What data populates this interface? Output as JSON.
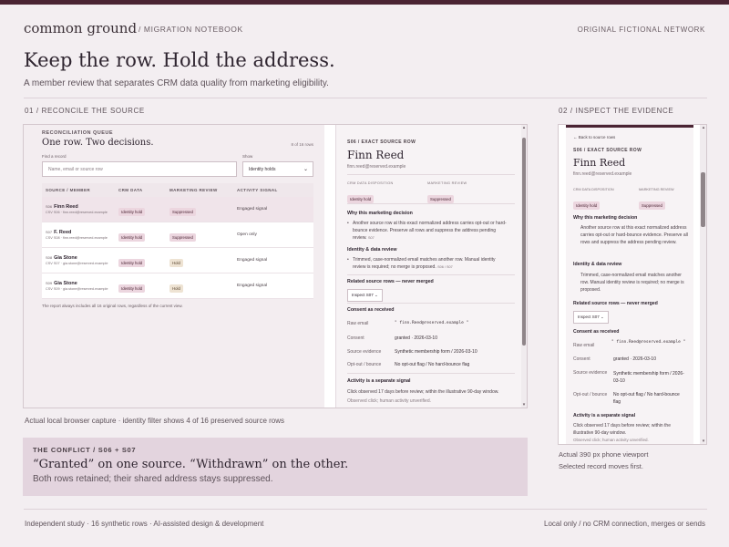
{
  "brand": "common ground",
  "breadcrumb": "/ MIGRATION NOTEBOOK",
  "network": "ORIGINAL FICTIONAL NETWORK",
  "headline": "Keep the row. Hold the address.",
  "subtitle": "A member review that separates CRM data quality from marketing eligibility.",
  "sections": {
    "left": "01 / RECONCILE THE SOURCE",
    "right": "02 / INSPECT THE EVIDENCE"
  },
  "queue": {
    "label": "RECONCILIATION QUEUE",
    "title": "One row. Two decisions.",
    "count": "8 of 16 rows",
    "find_label": "Find a record",
    "find_placeholder": "Name, email or source row",
    "show_label": "Show",
    "show_value": "Identity holds",
    "columns": [
      "SOURCE / MEMBER",
      "CRM DATA",
      "MARKETING REVIEW",
      "ACTIVITY SIGNAL"
    ],
    "rows": [
      {
        "idx": "S06",
        "name": "Finn Reed",
        "sub": "CSV S06 · finn.reed@reserved.example",
        "crm": "Identity hold",
        "review": "Suppressed",
        "signal": "Engaged signal"
      },
      {
        "idx": "S07",
        "name": "F. Reed",
        "sub": "CSV S08 · finn.reed@reserved.example",
        "crm": "Identity hold",
        "review": "Suppressed",
        "signal": "Open only"
      },
      {
        "idx": "S08",
        "name": "Gia Stone",
        "sub": "CSV S07 · gia.stone@reserved.example",
        "crm": "Identity hold",
        "review": "Hold",
        "signal": "Engaged signal"
      },
      {
        "idx": "S09",
        "name": "Gia Stone",
        "sub": "CSV S09 · gia.stone@reserved.example",
        "crm": "Identity hold",
        "review": "Hold",
        "signal": "Engaged signal"
      }
    ],
    "note": "The report always includes all 16 original rows, regardless of the current view."
  },
  "detail": {
    "label": "S06 / EXACT SOURCE ROW",
    "name": "Finn Reed",
    "email": "finn.reed@reserved.example",
    "disp_label": "CRM DATA DISPOSITION",
    "disp_value": "Identity hold",
    "review_label": "MARKETING REVIEW",
    "review_value": "Suppressed",
    "why_heading": "Why this marketing decision",
    "why_text": "Another source row at this exact normalized address carries opt-out or hard-bounce evidence. Preserve all rows and suppress the address pending review.",
    "why_tag": "S07",
    "identity_heading": "Identity & data review",
    "identity_text": "Trimmed, case-normalized email matches another row. Manual identity review is required; no merge is proposed.",
    "identity_tag": "S06 / S07",
    "related_heading": "Related source rows — never merged",
    "inspect_button": "Inspect S07",
    "consent_heading": "Consent as received",
    "consent": [
      {
        "k": "Raw email",
        "v": "\" finn.Reed@reserved.example \""
      },
      {
        "k": "Consent",
        "v": "granted · 2026-03-10"
      },
      {
        "k": "Source evidence",
        "v": "Synthetic membership form / 2026-03-10"
      },
      {
        "k": "Opt-out / bounce",
        "v": "No opt-out flag / No hard-bounce flag"
      }
    ],
    "activity_heading": "Activity is a separate signal",
    "activity_text": "Click observed 17 days before review; within the illustrative 90-day window.",
    "activity_more": "Observed click; human activity unverified."
  },
  "phone": {
    "back": "← Back to source rows",
    "disp_label": "CRM DATA DISPOSITION",
    "review_label": "MARKETING REVIEW",
    "why_text": "Another source row at this exact normalized address carries opt-out or hard-bounce evidence. Preserve all rows and suppress the address pending review.",
    "identity_text": "Trimmed, case-normalized email matches another row. Manual identity review is required; no merge is proposed.",
    "source_value": "Synthetic membership form / 2026-03-10",
    "optout_label": "Opt-out / bounce",
    "optout_value": "No opt-out flag / No hard-bounce flag",
    "activity_text": "Click observed 17 days before review; within the illustrative 90-day window.",
    "activity_more": "Observed click; human activity unverified."
  },
  "captions": {
    "desktop": "Actual local browser capture · identity filter shows 4 of 16 preserved source rows",
    "phone1": "Actual 390 px phone viewport",
    "phone2": "Selected record moves first."
  },
  "conflict": {
    "label": "THE CONFLICT / S06 + S07",
    "title": "“Granted” on one source. “Withdrawn” on the other.",
    "sub": "Both rows retained; their shared address stays suppressed."
  },
  "footer": {
    "left": "Independent study · 16 synthetic rows · AI-assisted design & development",
    "right": "Local only / no CRM connection, merges or sends"
  }
}
